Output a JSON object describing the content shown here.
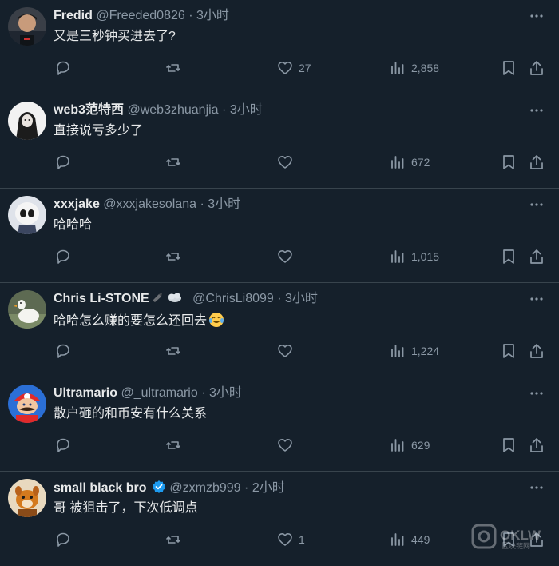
{
  "tweets": [
    {
      "name": "Fredid",
      "handle": "@Freeded0826",
      "sep": "·",
      "time": "3小时",
      "text": "又是三秒钟买进去了?",
      "likes": "27",
      "views": "2,858",
      "verified": false
    },
    {
      "name": "web3范特西",
      "handle": "@web3zhuanjia",
      "sep": "·",
      "time": "3小时",
      "text": "直接说亏多少了",
      "likes": "",
      "views": "672",
      "verified": false
    },
    {
      "name": "xxxjake",
      "handle": "@xxxjakesolana",
      "sep": "·",
      "time": "3小时",
      "text": "哈哈哈",
      "likes": "",
      "views": "1,015",
      "verified": false
    },
    {
      "name": "Chris Li-STONE",
      "handle": "@ChrisLi8099",
      "sep": "·",
      "time": "3小时",
      "text": "哈哈怎么赚的要怎么还回去",
      "likes": "",
      "views": "1,224",
      "verified": false
    },
    {
      "name": "Ultramario",
      "handle": "@_ultramario",
      "sep": "·",
      "time": "3小时",
      "text": "散户砸的和币安有什么关系",
      "likes": "",
      "views": "629",
      "verified": false
    },
    {
      "name": "small black bro",
      "handle": "@zxmzb999",
      "sep": "·",
      "time": "2小时",
      "text": "哥 被狙击了，下次低调点",
      "likes": "1",
      "views": "449",
      "verified": true
    }
  ],
  "colors": {
    "background": "#15202b",
    "primary_text": "#e7e9ea",
    "secondary_text": "#8b98a5",
    "divider": "#38444d",
    "verified": "#1d9bf0"
  },
  "icons": [
    "reply-icon",
    "retweet-icon",
    "like-icon",
    "views-icon",
    "bookmark-icon",
    "share-icon",
    "more-icon",
    "verified-badge-icon"
  ],
  "watermark": {
    "text": "OKLW",
    "subtext": "区块链网"
  }
}
